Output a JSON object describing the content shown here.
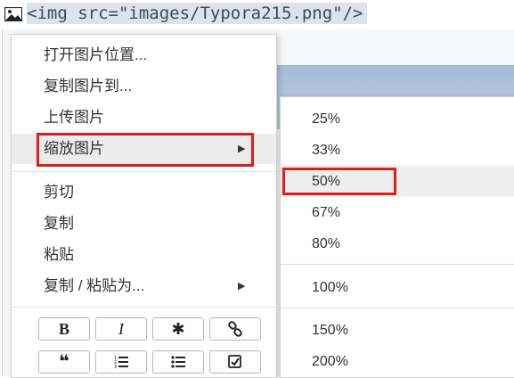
{
  "source": {
    "code": "<img src=\"images/Typora215.png\"/>",
    "icon": "image-icon"
  },
  "context_menu": {
    "items": [
      {
        "label": "打开图片位置..."
      },
      {
        "label": "复制图片到..."
      },
      {
        "label": "上传图片"
      },
      {
        "label": "缩放图片",
        "has_submenu": true
      }
    ],
    "edit_items": [
      {
        "label": "剪切"
      },
      {
        "label": "复制"
      },
      {
        "label": "粘贴"
      },
      {
        "label": "复制 / 粘贴为...",
        "has_submenu": true
      }
    ],
    "format_buttons": [
      {
        "label": "B",
        "icon": "bold-icon"
      },
      {
        "label": "I",
        "icon": "italic-icon"
      },
      {
        "label": "✱",
        "icon": "asterisk-icon"
      },
      {
        "label": "",
        "icon": "link-icon"
      },
      {
        "label": "❝",
        "icon": "quote-icon"
      },
      {
        "label": "",
        "icon": "ordered-list-icon"
      },
      {
        "label": "",
        "icon": "unordered-list-icon"
      },
      {
        "label": "",
        "icon": "task-list-icon"
      }
    ],
    "highlight_color": "#e21c1c"
  },
  "zoom_submenu": {
    "items": [
      {
        "label": "25%"
      },
      {
        "label": "33%"
      },
      {
        "label": "50%",
        "selected": true
      },
      {
        "label": "67%"
      },
      {
        "label": "80%"
      },
      {
        "label": "100%"
      },
      {
        "label": "150%"
      },
      {
        "label": "200%"
      }
    ]
  }
}
